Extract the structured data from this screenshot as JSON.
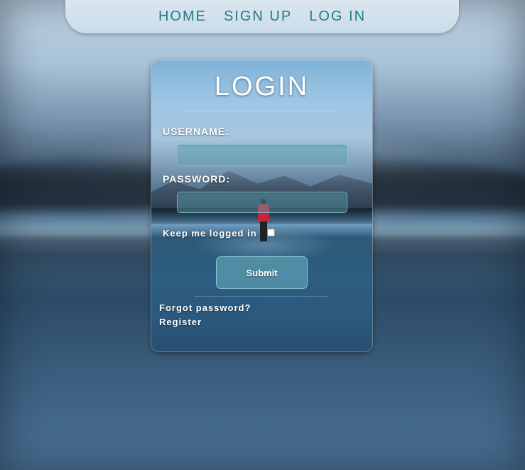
{
  "nav": {
    "items": [
      "HOME",
      "SIGN UP",
      "LOG IN"
    ]
  },
  "login": {
    "title": "LOGIN",
    "username_label": "USERNAME:",
    "username_value": "",
    "password_label": "PASSWORD:",
    "password_value": "",
    "keep_logged_in_label": "Keep me logged in",
    "keep_logged_in_checked": false,
    "submit_label": "Submit",
    "forgot_password_label": "Forgot password?",
    "register_label": "Register"
  },
  "colors": {
    "nav_text": "#1f7d86",
    "card_text": "#ffffff",
    "coat": "#c8243a"
  }
}
